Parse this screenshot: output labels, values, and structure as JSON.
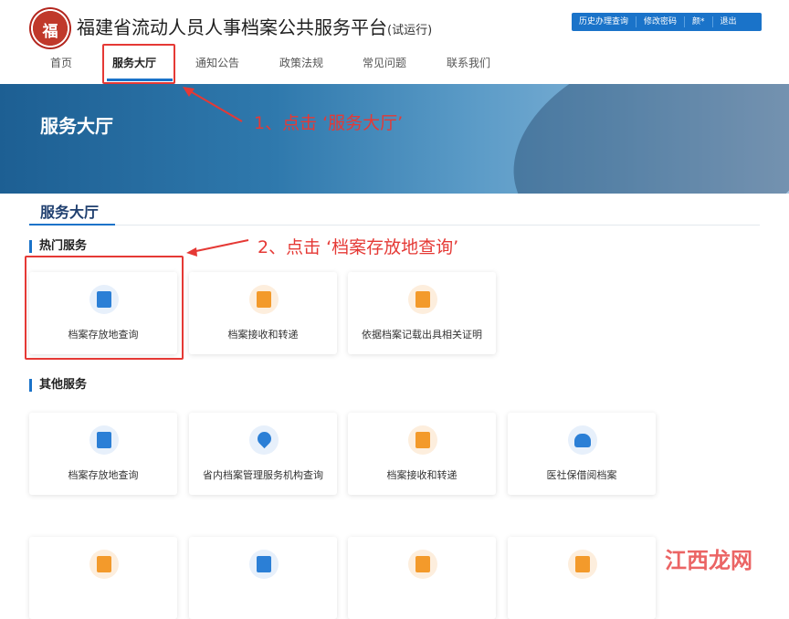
{
  "header": {
    "logo_char": "福",
    "title": "福建省流动人员人事档案公共服务平台",
    "title_suffix": "(试运行)",
    "top_links": [
      "历史办理查询",
      "修改密码",
      "颜*",
      "退出"
    ],
    "logo_icon": "seal-icon"
  },
  "nav": {
    "items": [
      "首页",
      "服务大厅",
      "通知公告",
      "政策法规",
      "常见问题",
      "联系我们"
    ],
    "active": "服务大厅"
  },
  "banner": {
    "title": "服务大厅"
  },
  "annotations": {
    "step1": "1、点击 ‘服务大厅’",
    "step2": "2、点击 ‘档案存放地查询’"
  },
  "section": {
    "tab": "服务大厅"
  },
  "hot_services": {
    "title": "热门服务",
    "cards": [
      {
        "label": "档案存放地查询",
        "icon": "document-search-icon",
        "color": "blue"
      },
      {
        "label": "档案接收和转递",
        "icon": "folder-transfer-icon",
        "color": "orange"
      },
      {
        "label": "依据档案记载出具相关证明",
        "icon": "stamp-icon",
        "color": "orange"
      }
    ]
  },
  "other_services": {
    "title": "其他服务",
    "cards": [
      {
        "label": "档案存放地查询",
        "icon": "document-search-icon",
        "color": "blue"
      },
      {
        "label": "省内档案管理服务机构查询",
        "icon": "location-pin-icon",
        "color": "blue"
      },
      {
        "label": "档案接收和转递",
        "icon": "folder-transfer-icon",
        "color": "orange"
      },
      {
        "label": "医社保借阅档案",
        "icon": "heart-icon",
        "color": "blue"
      }
    ],
    "row2_icons": [
      {
        "icon": "stamp-icon",
        "color": "orange"
      },
      {
        "icon": "user-settings-icon",
        "color": "blue"
      },
      {
        "icon": "archive-box-icon",
        "color": "orange"
      },
      {
        "icon": "document-yen-icon",
        "color": "orange"
      }
    ]
  },
  "watermark": "江西龙网",
  "colors": {
    "brand": "#1a73c9",
    "annotation": "#e53935",
    "orange_icon": "#f39a2b",
    "blue_icon": "#2b7fd6"
  }
}
